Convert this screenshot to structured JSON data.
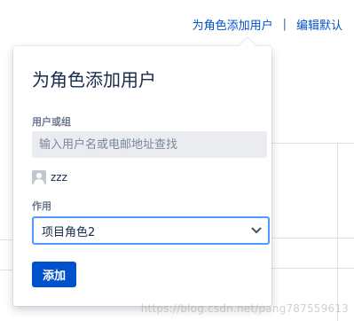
{
  "header": {
    "add_user_link": "为角色添加用户",
    "separator": "|",
    "edit_defaults_link": "编辑默认"
  },
  "dialog": {
    "title": "为角色添加用户",
    "users_label": "用户或组",
    "search_placeholder": "输入用户名或电邮地址查找",
    "selected_user": "zzz",
    "role_label": "作用",
    "role_selected": "项目角色2",
    "add_button": "添加"
  },
  "watermark": "https://blog.csdn.net/pang787559613",
  "colors": {
    "link": "#0052cc",
    "primary_button": "#0052cc",
    "focus_border": "#4c9aff",
    "field_bg": "#ebecf0"
  }
}
